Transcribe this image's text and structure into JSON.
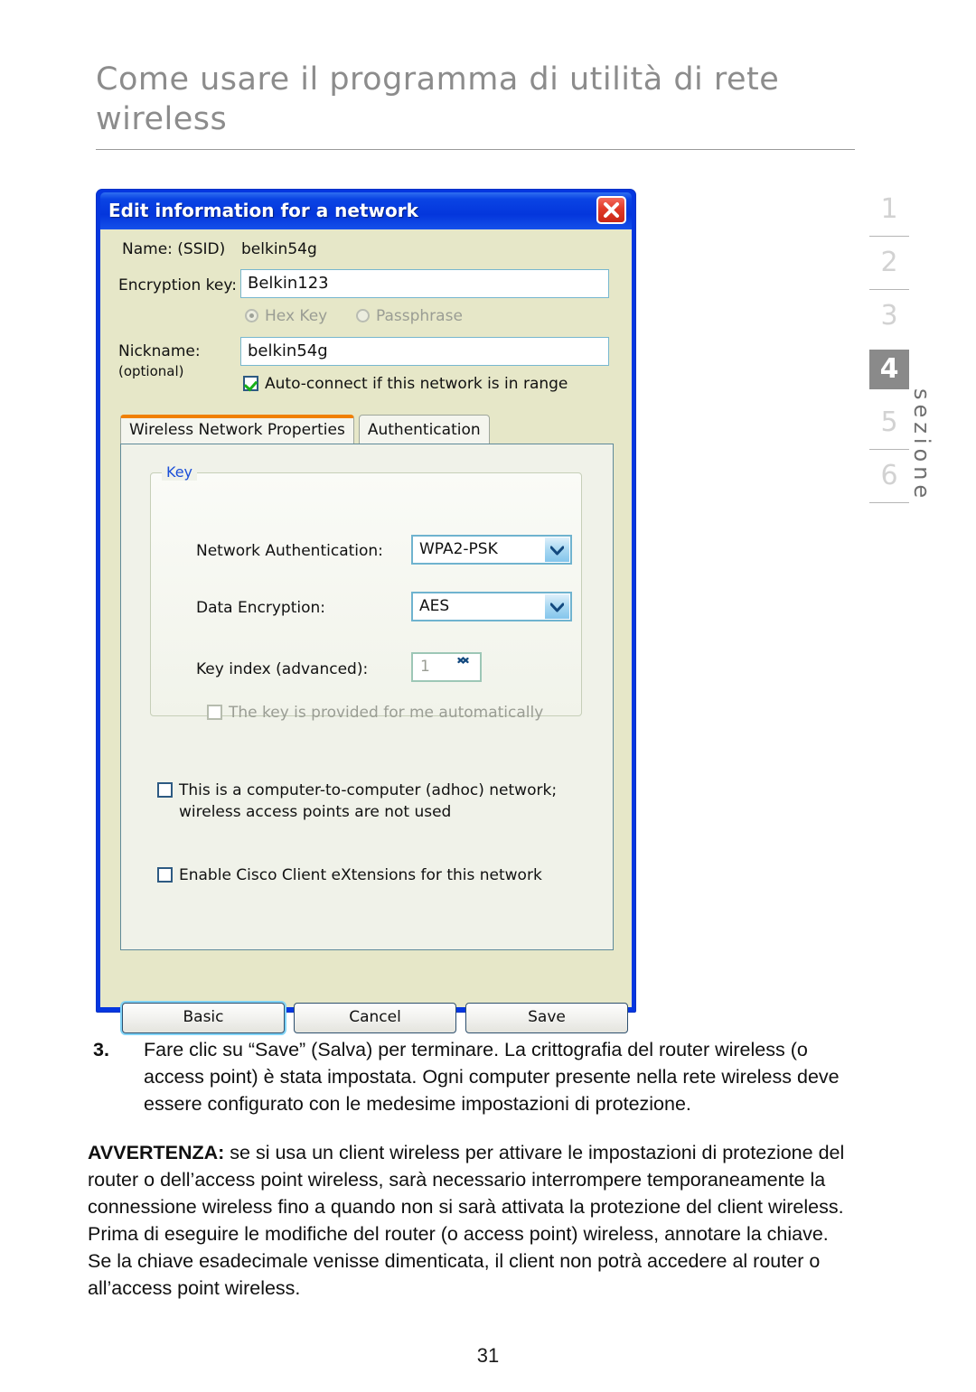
{
  "page": {
    "heading_line1": "Come usare il programma di utilità di rete",
    "heading_line2": "wireless",
    "page_number": "31"
  },
  "section_rail": {
    "label": "sezione",
    "numbers": [
      "1",
      "2",
      "3",
      "4",
      "5",
      "6"
    ],
    "active": "4",
    "active_bg": "#8a8a8a",
    "inactive_color": "#d2d2d2"
  },
  "dialog": {
    "title": "Edit information for a network",
    "close_icon": "close-icon",
    "titlebar_color": "#0436dc",
    "body_color": "#e6e7c8",
    "name_label": "Name:   (SSID)",
    "ssid_value": "belkin54g",
    "encryption_key_label": "Encryption key:",
    "encryption_key_value": "Belkin123",
    "key_type_options": [
      "Hex Key",
      "Passphrase"
    ],
    "key_type_selected": "Hex Key",
    "nickname_label": "Nickname:",
    "nickname_optional": "(optional)",
    "nickname_value": "belkin54g",
    "autoconnect_label": "Auto-connect if this network is in range",
    "autoconnect_checked": true,
    "tabs": [
      {
        "label": "Wireless Network Properties",
        "active": true
      },
      {
        "label": "Authentication",
        "active": false
      }
    ],
    "active_tab_accent": "#f08000",
    "key_group": {
      "title": "Key",
      "title_color": "#1b4fd8",
      "network_auth_label": "Network Authentication:",
      "network_auth_value": "WPA2-PSK",
      "data_encryption_label": "Data Encryption:",
      "data_encryption_value": "AES",
      "key_index_label": "Key index (advanced):",
      "key_index_value": "1",
      "key_auto_label": "The key is provided for me automatically",
      "key_auto_checked": false
    },
    "adhoc_label_line1": "This is a computer-to-computer (adhoc) network;",
    "adhoc_label_line2": "wireless access points are not used",
    "adhoc_checked": false,
    "cisco_label": "Enable Cisco Client eXtensions for this network",
    "cisco_checked": false,
    "buttons": {
      "basic": "Basic",
      "cancel": "Cancel",
      "save": "Save"
    }
  },
  "body": {
    "step_number": "3.",
    "step_text": "Fare clic su “Save” (Salva) per terminare. La crittografia del router wireless (o access point) è stata impostata. Ogni computer presente nella rete wireless  deve essere configurato con le medesime impostazioni di protezione.",
    "warning_label": "AVVERTENZA:",
    "warning_text": " se si usa un client wireless per attivare le impostazioni di protezione del router o dell’access point wireless, sarà necessario interrompere temporaneamente la connessione wireless fino a quando non si sarà attivata la protezione del client wireless. Prima di eseguire le modifiche del router (o access point) wireless, annotare la chiave. Se la chiave esadecimale venisse dimenticata, il client non potrà accedere al router o all’access point wireless."
  }
}
